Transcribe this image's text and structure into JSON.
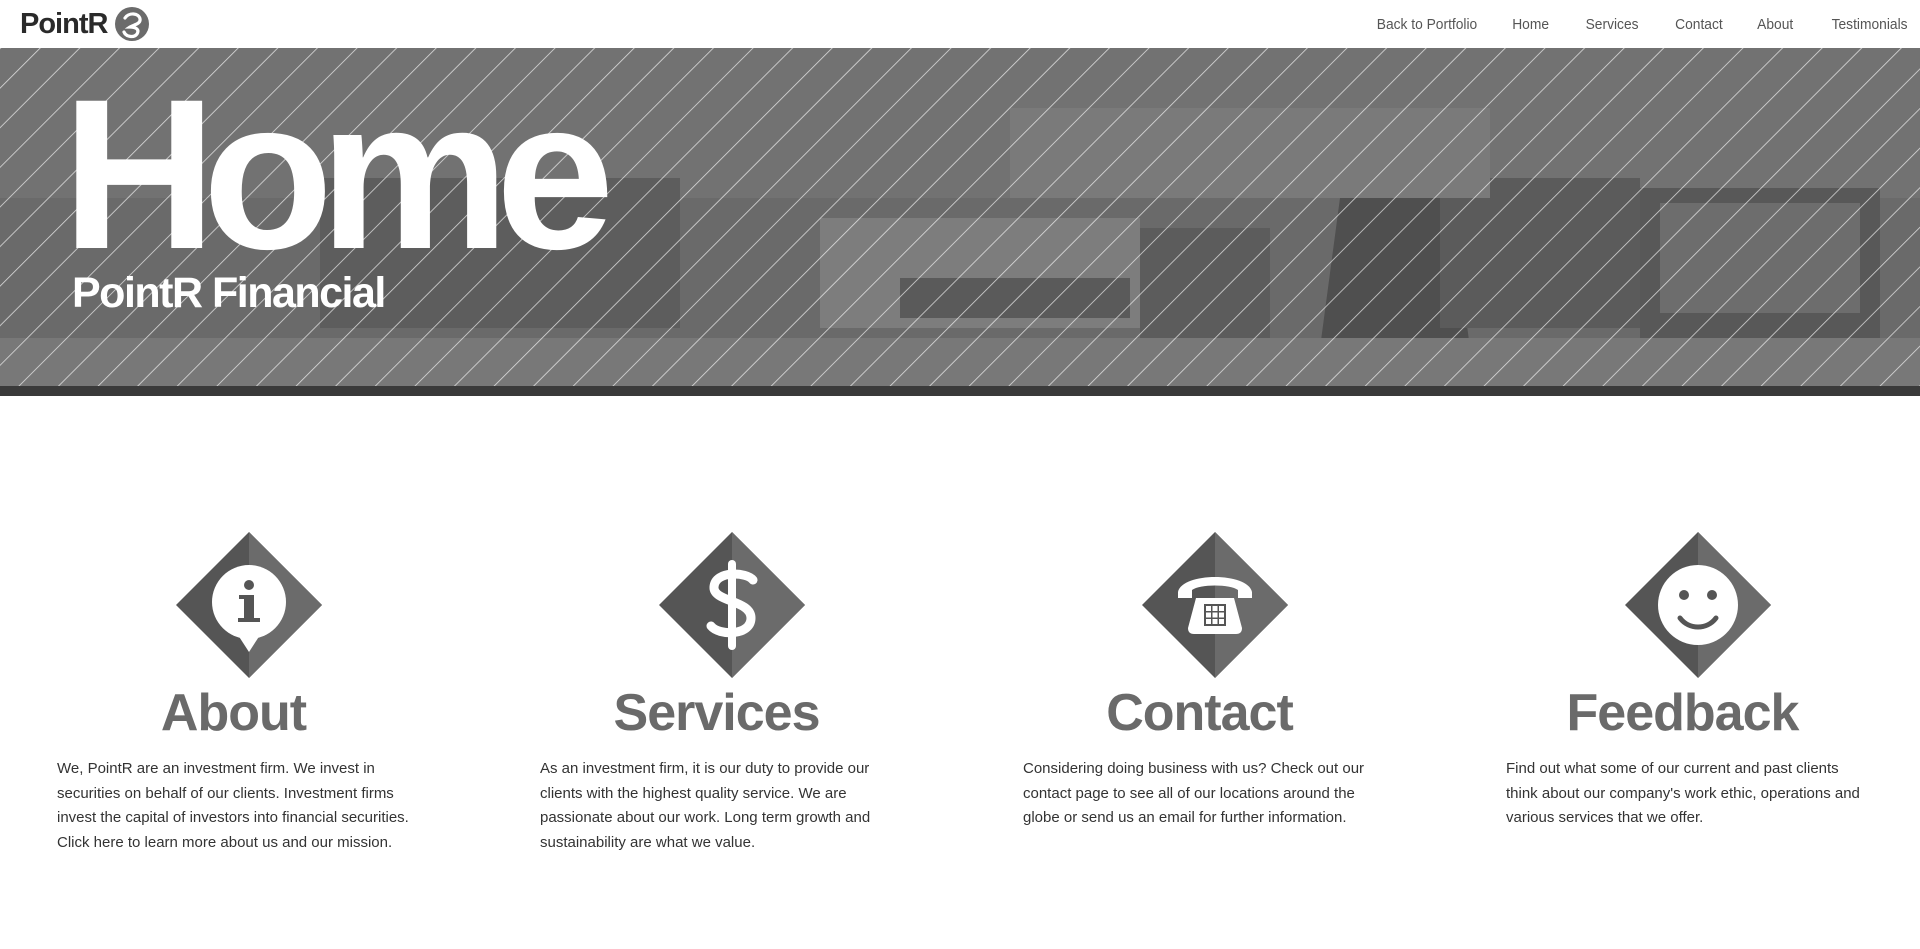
{
  "header": {
    "logo_text": "PointR",
    "nav": [
      {
        "label": "Back to Portfolio"
      },
      {
        "label": "Home"
      },
      {
        "label": "Services"
      },
      {
        "label": "Contact"
      },
      {
        "label": "About"
      },
      {
        "label": "Testimonials"
      }
    ]
  },
  "hero": {
    "title": "Home",
    "subtitle": "PointR Financial"
  },
  "features": [
    {
      "icon": "info-icon",
      "title": "About",
      "text": "We, PointR are an investment firm. We invest in securities on behalf of our clients. Investment firms invest the capital of investors into financial securities. Click here to learn more about us and our mission."
    },
    {
      "icon": "dollar-icon",
      "title": "Services",
      "text": "As an investment firm, it is our duty to provide our clients with the highest quality service. We are passionate about our work. Long term growth and sustainability are what we value."
    },
    {
      "icon": "telephone-icon",
      "title": "Contact",
      "text": "Considering doing business with us? Check out our contact page to see all of our locations around the globe or send us an email for further information."
    },
    {
      "icon": "smiley-icon",
      "title": "Feedback",
      "text": "Find out what some of our current and past clients think about our company's work ethic, operations and various services that we offer."
    }
  ],
  "colors": {
    "hero_overlay": "#6f6f6f",
    "hero_bar": "#3a3a3a",
    "icon_dark": "#555555",
    "icon_light": "#6b6b6b",
    "heading": "#6a6a6a"
  }
}
